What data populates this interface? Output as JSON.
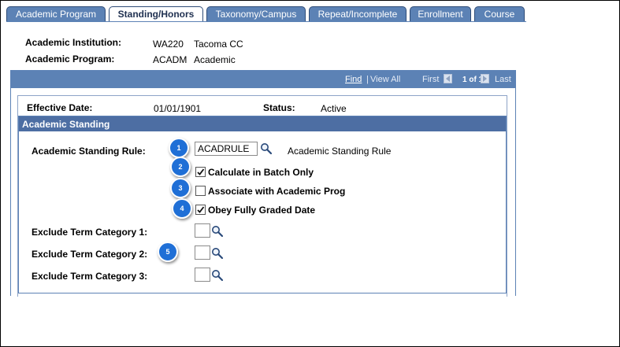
{
  "tabs": [
    {
      "label": "Academic Program",
      "active": false
    },
    {
      "label": "Standing/Honors",
      "active": true
    },
    {
      "label": "Taxonomy/Campus",
      "active": false
    },
    {
      "label": "Repeat/Incomplete",
      "active": false
    },
    {
      "label": "Enrollment",
      "active": false
    },
    {
      "label": "Course",
      "active": false
    }
  ],
  "header": {
    "institution_label": "Academic Institution:",
    "institution_code": "WA220",
    "institution_name": "Tacoma CC",
    "program_label": "Academic Program:",
    "program_code": "ACADM",
    "program_name": "Academic"
  },
  "nav": {
    "find": "Find",
    "separator": "|",
    "view_all": "View All",
    "first": "First",
    "position": "1 of 1",
    "last": "Last"
  },
  "effective": {
    "date_label": "Effective Date:",
    "date_value": "01/01/1901",
    "status_label": "Status:",
    "status_value": "Active"
  },
  "standing": {
    "title": "Academic Standing",
    "rule_label": "Academic Standing Rule:",
    "rule_value": "ACADRULE",
    "rule_description": "Academic Standing Rule",
    "checkboxes": [
      {
        "label": "Calculate in Batch Only",
        "checked": true
      },
      {
        "label": "Associate with Academic Prog",
        "checked": false
      },
      {
        "label": "Obey Fully Graded Date",
        "checked": true
      }
    ],
    "exclude": [
      {
        "label": "Exclude Term Category 1:",
        "value": ""
      },
      {
        "label": "Exclude Term Category 2:",
        "value": ""
      },
      {
        "label": "Exclude Term Category 3:",
        "value": ""
      }
    ]
  },
  "callouts": [
    "1",
    "2",
    "3",
    "4",
    "5"
  ],
  "colors": {
    "tab_bg": "#5c82b5",
    "nav_bar": "#5c82b5",
    "group_header": "#4d6ea3",
    "callout": "#1f6fd6"
  }
}
